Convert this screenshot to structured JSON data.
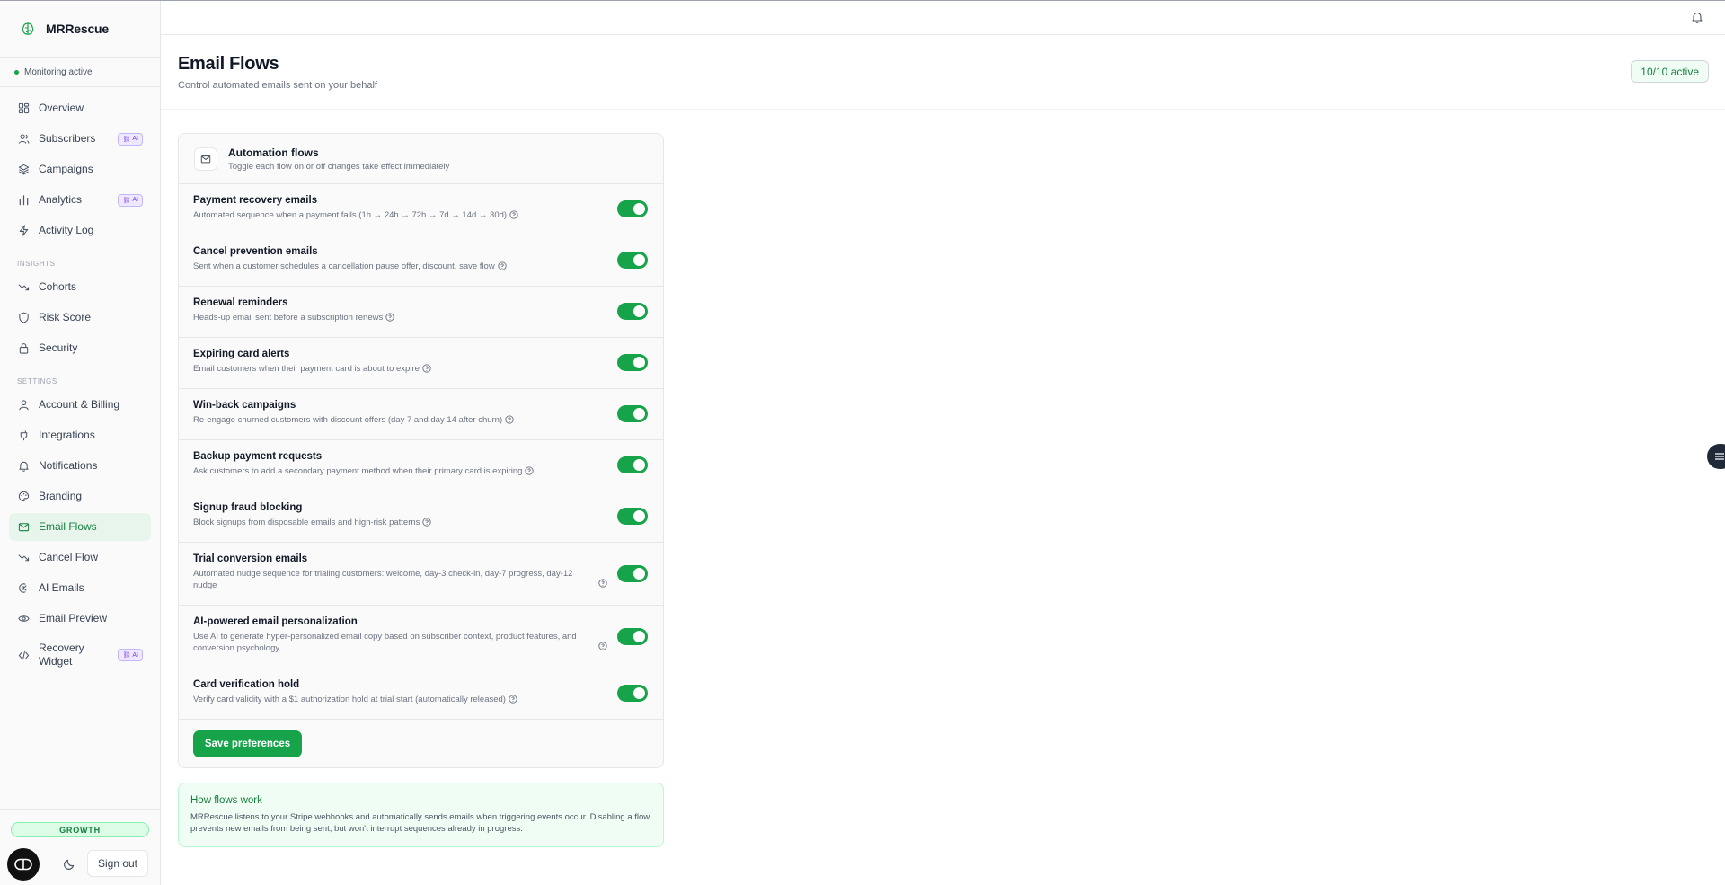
{
  "app": {
    "name": "MRRescue",
    "monitoring_status": "Monitoring active"
  },
  "sidebar": {
    "items_main": [
      {
        "label": "Overview",
        "icon": "grid-icon"
      },
      {
        "label": "Subscribers",
        "icon": "users-icon",
        "badge": "AI"
      },
      {
        "label": "Campaigns",
        "icon": "layers-icon"
      },
      {
        "label": "Analytics",
        "icon": "bar-chart-icon",
        "badge": "AI"
      },
      {
        "label": "Activity Log",
        "icon": "bolt-icon"
      }
    ],
    "insights_label": "INSIGHTS",
    "items_insights": [
      {
        "label": "Cohorts",
        "icon": "trend-down-icon"
      },
      {
        "label": "Risk Score",
        "icon": "shield-icon"
      },
      {
        "label": "Security",
        "icon": "lock-icon"
      }
    ],
    "settings_label": "SETTINGS",
    "items_settings": [
      {
        "label": "Account & Billing",
        "icon": "user-icon"
      },
      {
        "label": "Integrations",
        "icon": "plug-icon"
      },
      {
        "label": "Notifications",
        "icon": "bell-icon"
      },
      {
        "label": "Branding",
        "icon": "palette-icon"
      },
      {
        "label": "Email Flows",
        "icon": "mail-icon",
        "active": true
      },
      {
        "label": "Cancel Flow",
        "icon": "trend-down-icon"
      },
      {
        "label": "AI Emails",
        "icon": "ai-mail-icon"
      },
      {
        "label": "Email Preview",
        "icon": "eye-icon"
      },
      {
        "label": "Recovery Widget",
        "icon": "code-icon",
        "badge": "AI"
      }
    ],
    "plan": "GROWTH",
    "sign_out": "Sign out"
  },
  "header": {
    "title": "Email Flows",
    "subtitle": "Control automated emails sent on your behalf",
    "active_count": "10/10 active"
  },
  "card": {
    "title": "Automation flows",
    "description": "Toggle each flow on or off changes take effect immediately",
    "flows": [
      {
        "name": "Payment recovery emails",
        "description": "Automated sequence when a payment fails (1h → 24h → 72h → 7d → 14d → 30d)",
        "enabled": true
      },
      {
        "name": "Cancel prevention emails",
        "description": "Sent when a customer schedules a cancellation pause offer, discount, save flow",
        "enabled": true
      },
      {
        "name": "Renewal reminders",
        "description": "Heads-up email sent before a subscription renews",
        "enabled": true
      },
      {
        "name": "Expiring card alerts",
        "description": "Email customers when their payment card is about to expire",
        "enabled": true
      },
      {
        "name": "Win-back campaigns",
        "description": "Re-engage churned customers with discount offers (day 7 and day 14 after churn)",
        "enabled": true
      },
      {
        "name": "Backup payment requests",
        "description": "Ask customers to add a secondary payment method when their primary card is expiring",
        "enabled": true
      },
      {
        "name": "Signup fraud blocking",
        "description": "Block signups from disposable emails and high-risk patterns",
        "enabled": true
      },
      {
        "name": "Trial conversion emails",
        "description": "Automated nudge sequence for trialing customers: welcome, day-3 check-in, day-7 progress, day-12 nudge",
        "enabled": true
      },
      {
        "name": "AI-powered email personalization",
        "description": "Use AI to generate hyper-personalized email copy based on subscriber context, product features, and conversion psychology",
        "enabled": true
      },
      {
        "name": "Card verification hold",
        "description": "Verify card validity with a $1 authorization hold at trial start (automatically released)",
        "enabled": true
      }
    ],
    "save_label": "Save preferences"
  },
  "info": {
    "title": "How flows work",
    "text": "MRRescue listens to your Stripe webhooks and automatically sends emails when triggering events occur. Disabling a flow prevents new emails from being sent, but won't interrupt sequences already in progress."
  },
  "colors": {
    "accent": "#16a34a",
    "ai_badge": "#7c3aed"
  }
}
